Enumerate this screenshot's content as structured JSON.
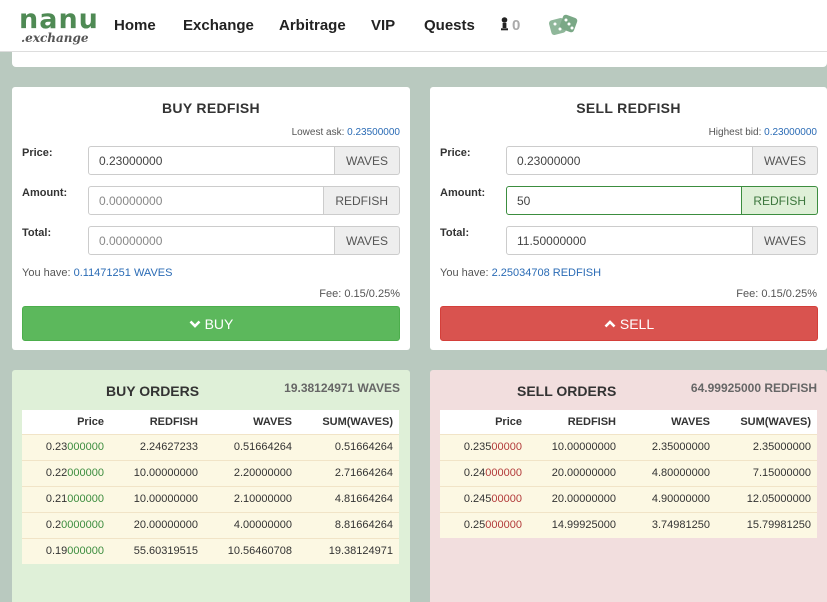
{
  "nav": {
    "logo_main": "nanu",
    "logo_sub": ".exchange",
    "links": [
      "Home",
      "Exchange",
      "Arbitrage",
      "VIP",
      "Quests"
    ],
    "user_count": "0"
  },
  "buy": {
    "title": "BUY REDFISH",
    "hint_label": "Lowest ask:",
    "hint_value": "0.23500000",
    "price_label": "Price:",
    "price_value": "0.23000000",
    "price_unit": "WAVES",
    "amount_label": "Amount:",
    "amount_placeholder": "0.00000000",
    "amount_unit": "REDFISH",
    "total_label": "Total:",
    "total_placeholder": "0.00000000",
    "total_unit": "WAVES",
    "have_label": "You have:",
    "have_value": "0.11471251 WAVES",
    "fee": "Fee: 0.15/0.25%",
    "button": "BUY"
  },
  "sell": {
    "title": "SELL REDFISH",
    "hint_label": "Highest bid:",
    "hint_value": "0.23000000",
    "price_label": "Price:",
    "price_value": "0.23000000",
    "price_unit": "WAVES",
    "amount_label": "Amount:",
    "amount_value": "50",
    "amount_unit": "REDFISH",
    "total_label": "Total:",
    "total_value": "11.50000000",
    "total_unit": "WAVES",
    "have_label": "You have:",
    "have_value": "2.25034708 REDFISH",
    "fee": "Fee: 0.15/0.25%",
    "button": "SELL"
  },
  "buy_orders": {
    "title": "BUY ORDERS",
    "total": "19.38124971 WAVES",
    "headers": [
      "Price",
      "REDFISH",
      "WAVES",
      "SUM(WAVES)"
    ],
    "rows": [
      [
        "0.23000000",
        "2.24627233",
        "0.51664264",
        "0.51664264"
      ],
      [
        "0.22000000",
        "10.00000000",
        "2.20000000",
        "2.71664264"
      ],
      [
        "0.21000000",
        "10.00000000",
        "2.10000000",
        "4.81664264"
      ],
      [
        "0.20000000",
        "20.00000000",
        "4.00000000",
        "8.81664264"
      ],
      [
        "0.19000000",
        "55.60319515",
        "10.56460708",
        "19.38124971"
      ]
    ]
  },
  "sell_orders": {
    "title": "SELL ORDERS",
    "total": "64.99925000 REDFISH",
    "headers": [
      "Price",
      "REDFISH",
      "WAVES",
      "SUM(WAVES)"
    ],
    "rows": [
      [
        "0.23500000",
        "10.00000000",
        "2.35000000",
        "2.35000000"
      ],
      [
        "0.24000000",
        "20.00000000",
        "4.80000000",
        "7.15000000"
      ],
      [
        "0.24500000",
        "20.00000000",
        "4.90000000",
        "12.05000000"
      ],
      [
        "0.25000000",
        "14.99925000",
        "3.74981250",
        "15.79981250"
      ]
    ]
  },
  "colors": {
    "buy_green": "#5cb85c",
    "sell_red": "#d9534f",
    "link_blue": "#2a6bb5",
    "page_bg": "#b9c9bf"
  }
}
